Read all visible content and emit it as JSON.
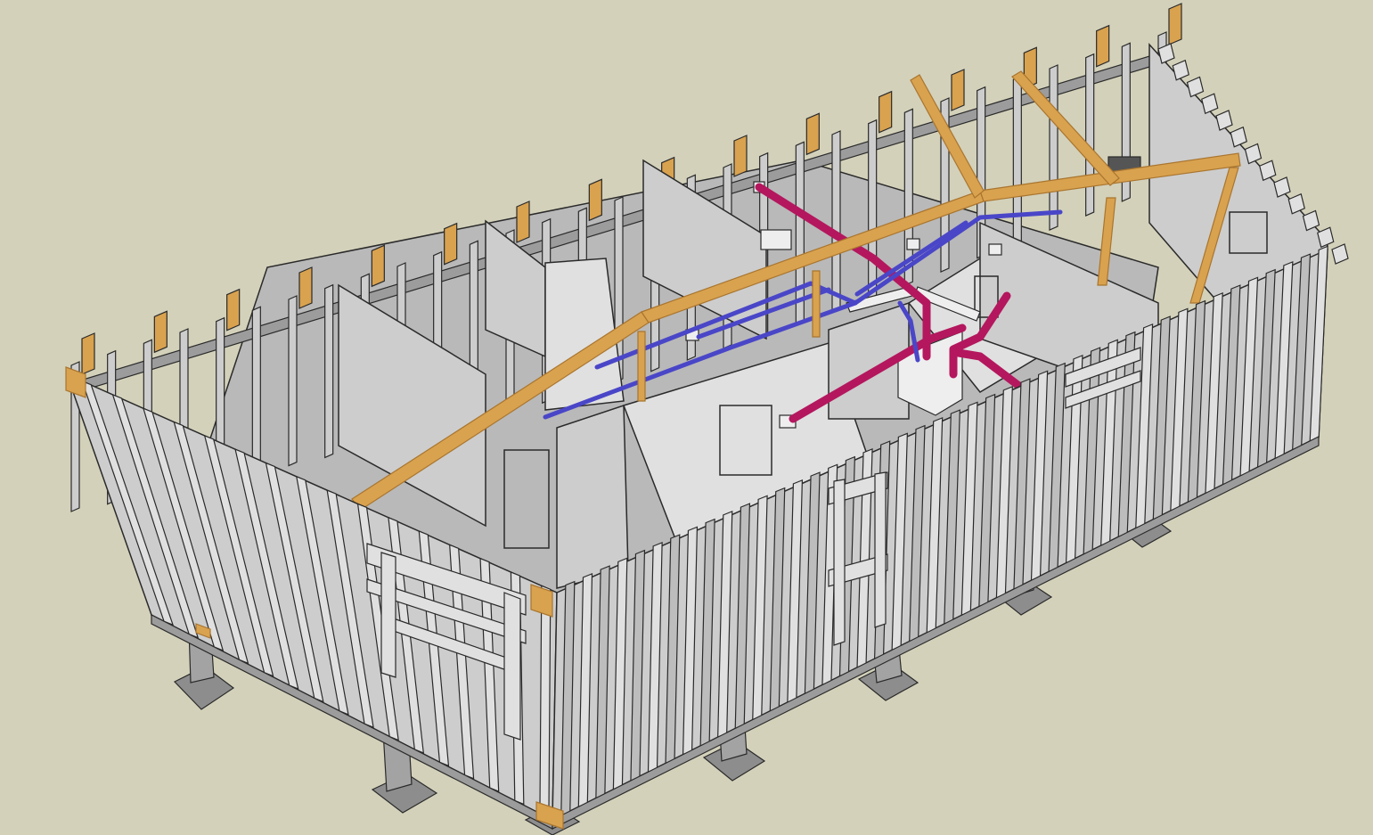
{
  "scene": {
    "background": "#d3d1ba",
    "colors": {
      "metal_face": "#cdcdcd",
      "metal_light": "#e0e0e0",
      "metal_dark": "#9c9c9c",
      "edge": "#2a2a2a",
      "wood": "#d9a24f",
      "wood_dark": "#a9752e",
      "cold_pipe": "#4a46c8",
      "hot_pipe": "#b4175e",
      "footing": "#8d8d8d",
      "pier": "#a3a3a3",
      "fixture": "#eeeeee"
    },
    "icons": {
      "floor": "floor-deck",
      "walls": "steel-stud-wall",
      "beam": "ridge-beam",
      "pipes": "plumbing-pipe",
      "piers": "concrete-pier"
    }
  }
}
